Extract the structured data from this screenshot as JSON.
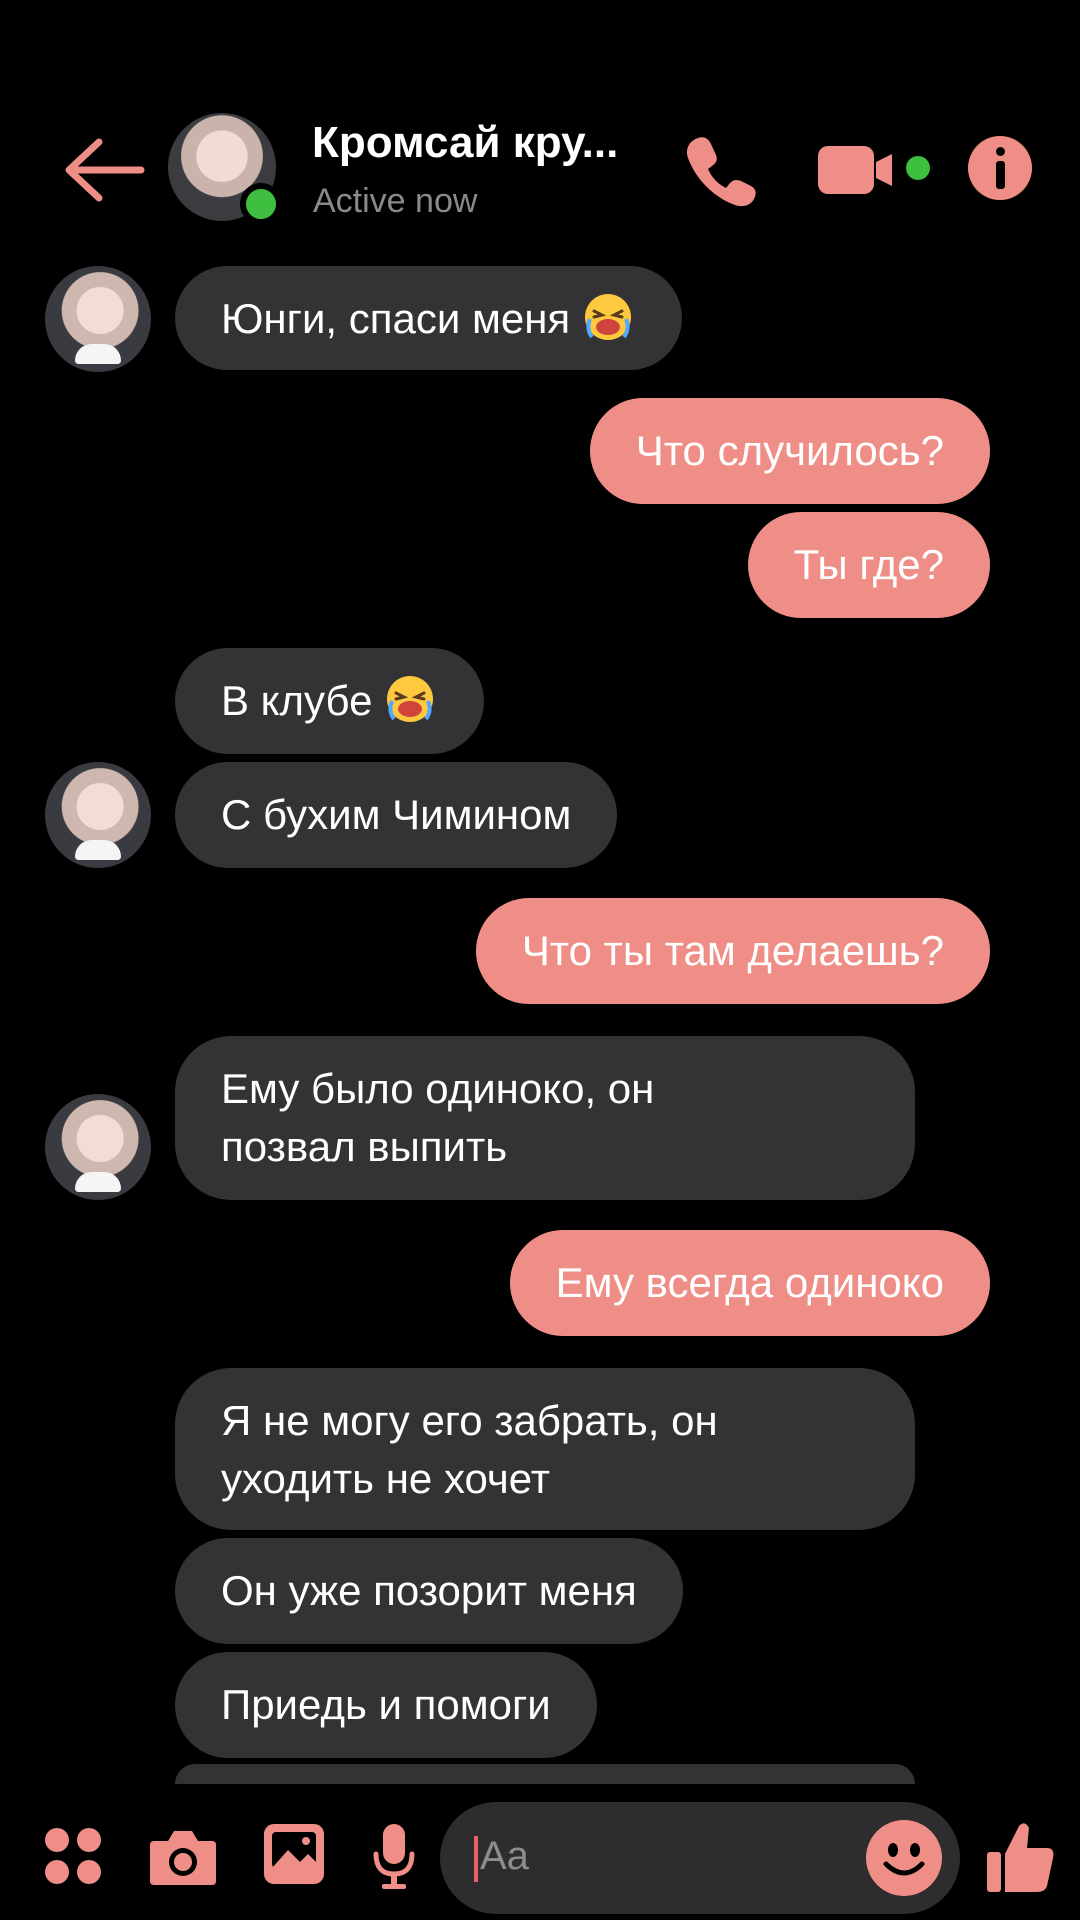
{
  "theme": {
    "accent": "#ef8e87",
    "incoming_bubble": "#333235",
    "background": "#000000",
    "online": "#3fbf3f"
  },
  "header": {
    "back_icon": "arrow-left-icon",
    "contact_name": "Кромсай кру...",
    "status": "Active now",
    "call_icon": "phone-icon",
    "video_icon": "video-camera-icon",
    "info_icon": "info-icon"
  },
  "messages": [
    {
      "dir": "in",
      "text": "Юнги, спаси меня",
      "emoji": "crying-face"
    },
    {
      "dir": "out",
      "text": "Что случилось?"
    },
    {
      "dir": "out",
      "text": "Ты где?"
    },
    {
      "dir": "in",
      "text": "В клубе",
      "emoji": "crying-face"
    },
    {
      "dir": "in",
      "text": "С бухим Чимином"
    },
    {
      "dir": "out",
      "text": "Что ты там делаешь?"
    },
    {
      "dir": "in",
      "line1": "Ему было одиноко, он",
      "line2": "позвал выпить"
    },
    {
      "dir": "out",
      "text": "Ему всегда одиноко"
    },
    {
      "dir": "in",
      "line1": "Я не могу его забрать, он",
      "line2": "уходить не хочет"
    },
    {
      "dir": "in",
      "text": "Он уже позорит меня"
    },
    {
      "dir": "in",
      "text": "Приедь и помоги"
    }
  ],
  "composer": {
    "placeholder": "Aa",
    "apps_icon": "apps-icon",
    "camera_icon": "camera-icon",
    "gallery_icon": "image-icon",
    "mic_icon": "microphone-icon",
    "emoji_icon": "smiley-icon",
    "like_icon": "thumbs-up-icon"
  }
}
